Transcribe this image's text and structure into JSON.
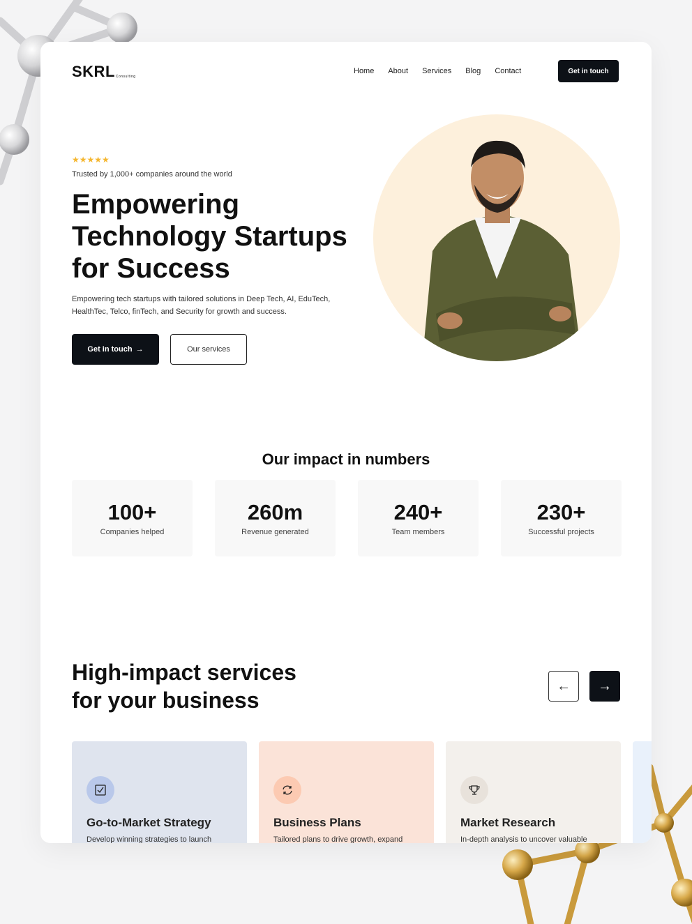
{
  "header": {
    "logo": "SKRL",
    "logo_sub": "Consulting",
    "nav": [
      "Home",
      "About",
      "Services",
      "Blog",
      "Contact"
    ],
    "cta": "Get in touch"
  },
  "hero": {
    "stars": "★★★★★",
    "trusted": "Trusted by 1,000+ companies around the world",
    "title": "Empowering Technology Startups for Success",
    "description": "Empowering tech startups with tailored solutions in Deep Tech, AI, EduTech, HealthTec, Telco, finTech, and Security for growth and success.",
    "primary_button": "Get in touch",
    "secondary_button": "Our services"
  },
  "impact": {
    "title": "Our impact in numbers",
    "stats": [
      {
        "value": "100+",
        "label": "Companies helped"
      },
      {
        "value": "260m",
        "label": "Revenue generated"
      },
      {
        "value": "240+",
        "label": "Team members"
      },
      {
        "value": "230+",
        "label": "Successful projects"
      }
    ]
  },
  "services": {
    "title_line1": "High-impact services",
    "title_line2": "for your business",
    "cards": [
      {
        "title": "Go-to-Market Strategy",
        "desc": "Develop winning strategies to launch",
        "icon": "checkbox-icon",
        "bg": "#dfe4ee",
        "icon_bg": "#b9c8ea"
      },
      {
        "title": "Business Plans",
        "desc": "Tailored plans to drive growth, expand",
        "icon": "refresh-icon",
        "bg": "#fbe3d8",
        "icon_bg": "#fccab2"
      },
      {
        "title": "Market Research",
        "desc": "In-depth analysis to uncover valuable",
        "icon": "trophy-icon",
        "bg": "#f3f0ec",
        "icon_bg": "#e8e2db"
      }
    ]
  },
  "colors": {
    "dark": "#0d1117",
    "star": "#f5b731",
    "hero_circle": "#fdf0dc",
    "jacket": "#5b5f34"
  }
}
